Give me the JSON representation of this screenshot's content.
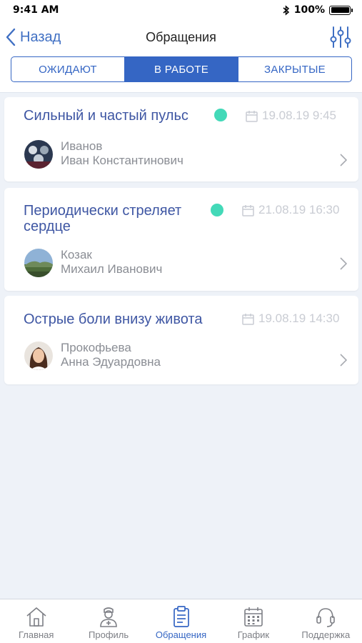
{
  "status_bar": {
    "time": "9:41 AM",
    "battery": "100%"
  },
  "nav": {
    "back_label": "Назад",
    "title": "Обращения"
  },
  "segments": [
    {
      "label": "ОЖИДАЮТ",
      "active": false
    },
    {
      "label": "В РАБОТЕ",
      "active": true
    },
    {
      "label": "ЗАКРЫТЫЕ",
      "active": false
    }
  ],
  "requests": [
    {
      "title": "Сильный и частый пульс",
      "date": "19.08.19 9:45",
      "status_color": "#43d9b8",
      "last_name": "Иванов",
      "first_name": "Иван Константинович"
    },
    {
      "title_line1": "Периодически стреляет",
      "title_line2": "сердце",
      "date": "21.08.19 16:30",
      "status_color": "#43d9b8",
      "last_name": "Козак",
      "first_name": "Михаил Иванович"
    },
    {
      "title": "Острые боли внизу живота",
      "date": "19.08.19 14:30",
      "last_name": "Прокофьева",
      "first_name": "Анна Эдуардовна"
    }
  ],
  "tabs": [
    {
      "label": "Главная",
      "icon": "home-icon",
      "active": false
    },
    {
      "label": "Профиль",
      "icon": "doctor-icon",
      "active": false
    },
    {
      "label": "Обращения",
      "icon": "clipboard-icon",
      "active": true
    },
    {
      "label": "График",
      "icon": "calendar-icon",
      "active": false
    },
    {
      "label": "Поддержка",
      "icon": "headset-icon",
      "active": false
    }
  ],
  "colors": {
    "accent": "#3566c4",
    "title_blue": "#3e56a3",
    "status_green": "#43d9b8",
    "background": "#eef2f8"
  }
}
